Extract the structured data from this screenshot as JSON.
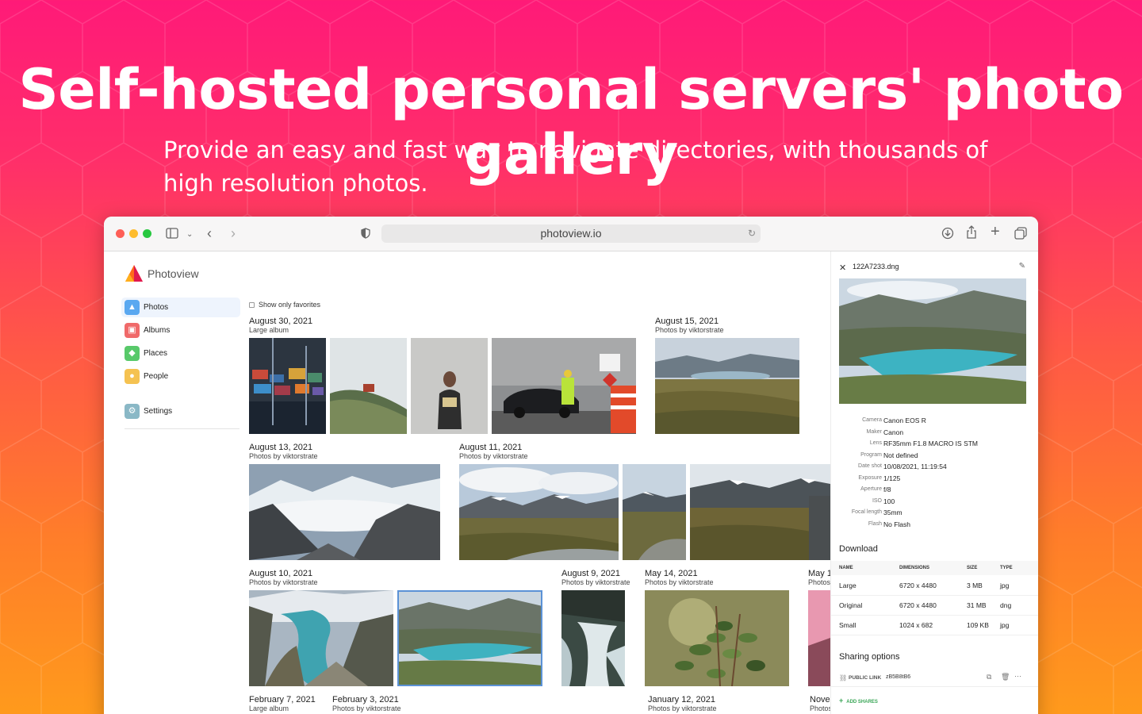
{
  "hero": {
    "title": "Self-hosted personal servers' photo gallery",
    "subtitle": "Provide an easy and fast way to navigate directories, with thousands of high resolution photos."
  },
  "browser": {
    "url": "photoview.io",
    "icons": [
      "sidebar-toggle-icon",
      "chevron-down-icon",
      "back-icon",
      "forward-icon",
      "shield-icon",
      "reload-icon",
      "download-icon",
      "share-icon",
      "new-tab-icon",
      "tabs-icon"
    ]
  },
  "app": {
    "name": "Photoview",
    "nav": [
      {
        "label": "Photos",
        "icon": "photos-icon",
        "color": "#5aa8f0"
      },
      {
        "label": "Albums",
        "icon": "albums-icon",
        "color": "#f06a6a"
      },
      {
        "label": "Places",
        "icon": "places-icon",
        "color": "#58c96a"
      },
      {
        "label": "People",
        "icon": "people-icon",
        "color": "#f5c251"
      },
      {
        "label": "Settings",
        "icon": "settings-icon",
        "color": "#8ab8c6"
      }
    ],
    "filter_label": "Show only favorites"
  },
  "groups": [
    {
      "date": "August 30, 2021",
      "sub": "Large album"
    },
    {
      "date": "August 15, 2021",
      "sub": "Photos by viktorstrate"
    },
    {
      "date": "August 13, 2021",
      "sub": "Photos by viktorstrate"
    },
    {
      "date": "August 11, 2021",
      "sub": "Photos by viktorstrate"
    },
    {
      "date": "August 10, 2021",
      "sub": "Photos by viktorstrate"
    },
    {
      "date": "August 9, 2021",
      "sub": "Photos by viktorstrate"
    },
    {
      "date": "May 14, 2021",
      "sub": "Photos by viktorstrate"
    },
    {
      "date": "May 1",
      "sub": "Photos"
    },
    {
      "date": "February 7, 2021",
      "sub": "Large album"
    },
    {
      "date": "February 3, 2021",
      "sub": "Photos by viktorstrate"
    },
    {
      "date": "January 12, 2021",
      "sub": "Photos by viktorstrate"
    },
    {
      "date": "Nove",
      "sub": "Photos"
    }
  ],
  "panel": {
    "filename": "122A7233.dng",
    "metadata": [
      {
        "key": "Camera",
        "value": "Canon EOS R"
      },
      {
        "key": "Maker",
        "value": "Canon"
      },
      {
        "key": "Lens",
        "value": "RF35mm F1.8 MACRO IS STM"
      },
      {
        "key": "Program",
        "value": "Not defined"
      },
      {
        "key": "Date shot",
        "value": "10/08/2021, 11:19:54"
      },
      {
        "key": "Exposure",
        "value": "1/125"
      },
      {
        "key": "Aperture",
        "value": "f/8"
      },
      {
        "key": "ISO",
        "value": "100"
      },
      {
        "key": "Focal length",
        "value": "35mm"
      },
      {
        "key": "Flash",
        "value": "No Flash"
      }
    ],
    "download_heading": "Download",
    "download_columns": [
      "NAME",
      "DIMENSIONS",
      "SIZE",
      "TYPE"
    ],
    "downloads": [
      {
        "name": "Large",
        "dimensions": "6720 x 4480",
        "size": "3 MB",
        "type": "jpg"
      },
      {
        "name": "Original",
        "dimensions": "6720 x 4480",
        "size": "31 MB",
        "type": "dng"
      },
      {
        "name": "Small",
        "dimensions": "1024 x 682",
        "size": "109 KB",
        "type": "jpg"
      }
    ],
    "sharing_heading": "Sharing options",
    "public_link_label": "PUBLIC LINK",
    "public_link_token": "zB5B8tB6",
    "add_shares_label": "ADD SHARES"
  }
}
